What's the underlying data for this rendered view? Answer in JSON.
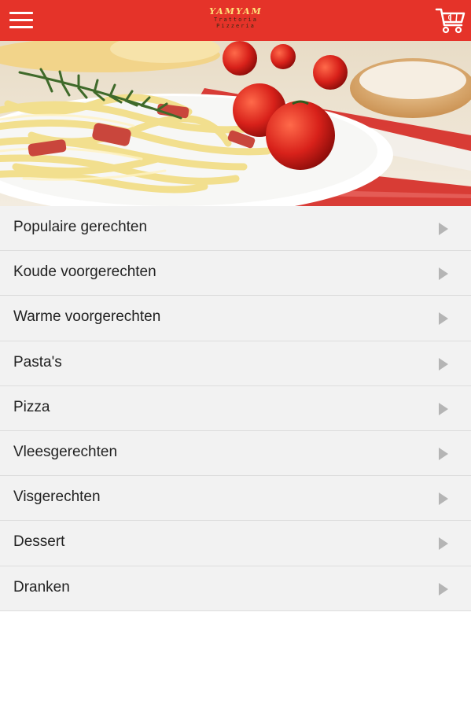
{
  "header": {
    "menu_icon": "hamburger-menu-icon",
    "logo_main": "YAMYAM",
    "logo_sub": "Trattoria Pizzeria",
    "cart_icon": "shopping-cart-icon",
    "cart_count": "0",
    "background_color": "#e53329"
  },
  "hero": {
    "image": "pasta-dish-photo"
  },
  "menu": {
    "items": [
      {
        "label": "Populaire gerechten"
      },
      {
        "label": "Koude voorgerechten"
      },
      {
        "label": "Warme voorgerechten"
      },
      {
        "label": "Pasta's"
      },
      {
        "label": "Pizza"
      },
      {
        "label": "Vleesgerechten"
      },
      {
        "label": "Visgerechten"
      },
      {
        "label": "Dessert"
      },
      {
        "label": "Dranken"
      }
    ],
    "chevron_icon": "chevron-right-icon"
  }
}
